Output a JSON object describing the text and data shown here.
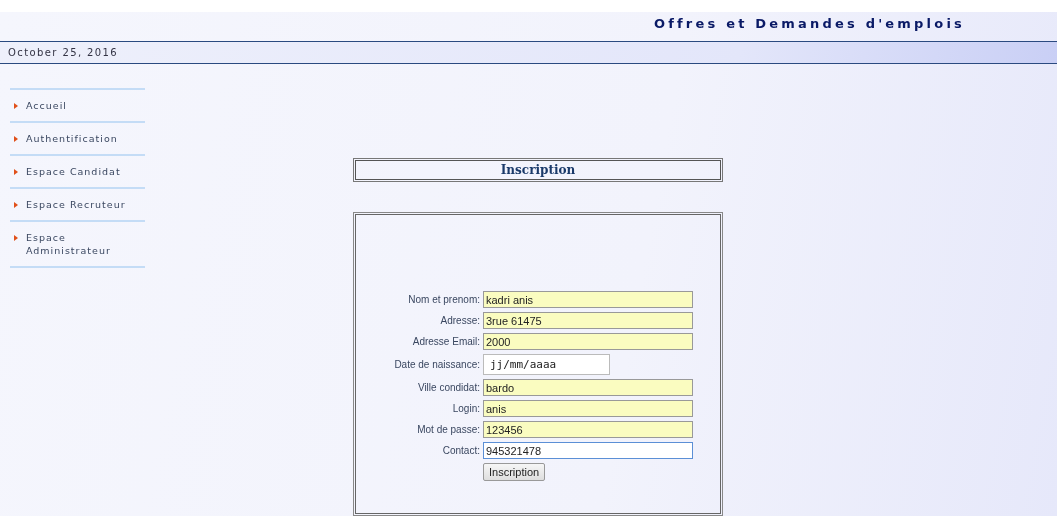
{
  "header": {
    "title": "Offres et Demandes d'emplois",
    "date": "October 25, 2016"
  },
  "sidebar": {
    "items": [
      {
        "label": "Accueil"
      },
      {
        "label": "Authentification"
      },
      {
        "label": "Espace Candidat"
      },
      {
        "label": "Espace Recruteur"
      },
      {
        "label": "Espace Administrateur"
      }
    ]
  },
  "panel": {
    "title": "Inscription"
  },
  "form": {
    "fields": [
      {
        "label": "Nom et prenom:",
        "kind": "text",
        "value": "kadri anis",
        "autofilled": true,
        "focused": false
      },
      {
        "label": "Adresse:",
        "kind": "text",
        "value": "3rue 61475",
        "autofilled": true,
        "focused": false
      },
      {
        "label": "Adresse Email:",
        "kind": "text",
        "value": "2000",
        "autofilled": true,
        "focused": false
      },
      {
        "label": "Date de naissance:",
        "kind": "date",
        "value": "jj/mm/aaaa",
        "autofilled": false,
        "focused": false
      },
      {
        "label": "Ville condidat:",
        "kind": "text",
        "value": "bardo",
        "autofilled": true,
        "focused": false
      },
      {
        "label": "Login:",
        "kind": "text",
        "value": "anis",
        "autofilled": true,
        "focused": false
      },
      {
        "label": "Mot de passe:",
        "kind": "text",
        "value": "123456",
        "autofilled": true,
        "focused": false
      },
      {
        "label": "Contact:",
        "kind": "text",
        "value": "945321478",
        "autofilled": false,
        "focused": true
      }
    ],
    "submit": "Inscription"
  }
}
